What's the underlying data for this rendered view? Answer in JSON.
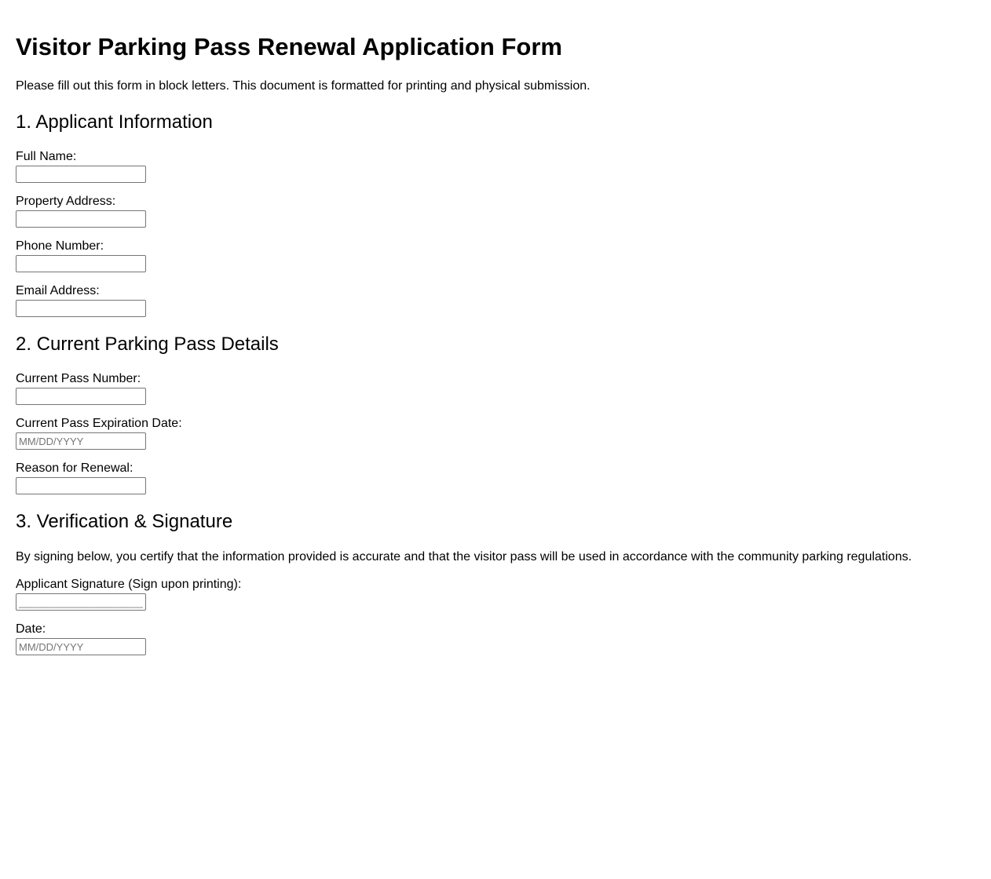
{
  "form": {
    "title": "Visitor Parking Pass Renewal Application Form",
    "intro": "Please fill out this form in block letters. This document is formatted for printing and physical submission.",
    "sections": {
      "applicant": {
        "heading": "1. Applicant Information",
        "full_name_label": "Full Name:",
        "property_address_label": "Property Address:",
        "phone_label": "Phone Number:",
        "email_label": "Email Address:"
      },
      "pass": {
        "heading": "2. Current Parking Pass Details",
        "pass_number_label": "Current Pass Number:",
        "expiration_label": "Current Pass Expiration Date:",
        "expiration_placeholder": "MM/DD/YYYY",
        "reason_label": "Reason for Renewal:"
      },
      "verification": {
        "heading": "3. Verification & Signature",
        "statement": "By signing below, you certify that the information provided is accurate and that the visitor pass will be used in accordance with the community parking regulations.",
        "signature_label": "Applicant Signature (Sign upon printing):",
        "signature_placeholder": "______________________",
        "date_label": "Date:",
        "date_placeholder": "MM/DD/YYYY"
      }
    }
  }
}
